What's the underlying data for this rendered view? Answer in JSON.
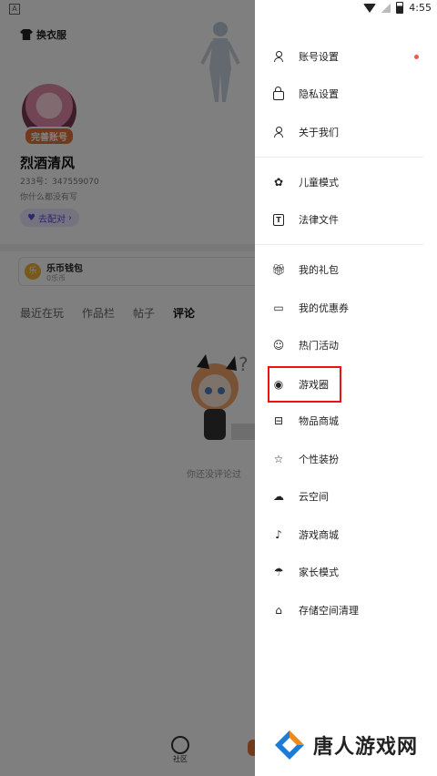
{
  "status_bar": {
    "time": "4:55",
    "left_badge": "A"
  },
  "background_page": {
    "dress_label": "换衣服",
    "complete_tag": "完善账号",
    "nickname": "烈酒清风",
    "uid": "233号：347559070",
    "bio": "你什么都没有写",
    "pair_button": "去配对",
    "wallet": {
      "title": "乐币钱包",
      "subtitle": "0乐币",
      "coin_symbol": "乐"
    },
    "tabs": [
      "最近在玩",
      "作品栏",
      "帖子",
      "评论"
    ],
    "active_tab": "评论",
    "empty_text": "你还没评论过",
    "nav": {
      "community": "社区"
    }
  },
  "drawer": {
    "items": [
      {
        "label": "账号设置",
        "icon": "person-icon",
        "badge": true
      },
      {
        "label": "隐私设置",
        "icon": "lock-icon"
      },
      {
        "label": "关于我们",
        "icon": "user-about-icon"
      },
      {
        "label": "儿童模式",
        "icon": "sprout-icon"
      },
      {
        "label": "法律文件",
        "icon": "document-icon"
      },
      {
        "label": "我的礼包",
        "icon": "gift-icon"
      },
      {
        "label": "我的优惠券",
        "icon": "ticket-icon"
      },
      {
        "label": "热门活动",
        "icon": "smile-icon"
      },
      {
        "label": "游戏圈",
        "icon": "game-circle-icon",
        "highlighted": true
      },
      {
        "label": "物品商城",
        "icon": "store-icon"
      },
      {
        "label": "个性装扮",
        "icon": "star-icon"
      },
      {
        "label": "云空间",
        "icon": "cloud-icon"
      },
      {
        "label": "游戏商城",
        "icon": "tiktok-icon"
      },
      {
        "label": "家长模式",
        "icon": "umbrella-icon"
      },
      {
        "label": "存储空间清理",
        "icon": "broom-icon"
      }
    ],
    "highlight_color": "#e11111",
    "badge_color": "#ef5a4f"
  },
  "watermark": {
    "text": "唐人游戏网",
    "colors": {
      "orange": "#f08a1c",
      "blue": "#1d7bd8"
    }
  }
}
